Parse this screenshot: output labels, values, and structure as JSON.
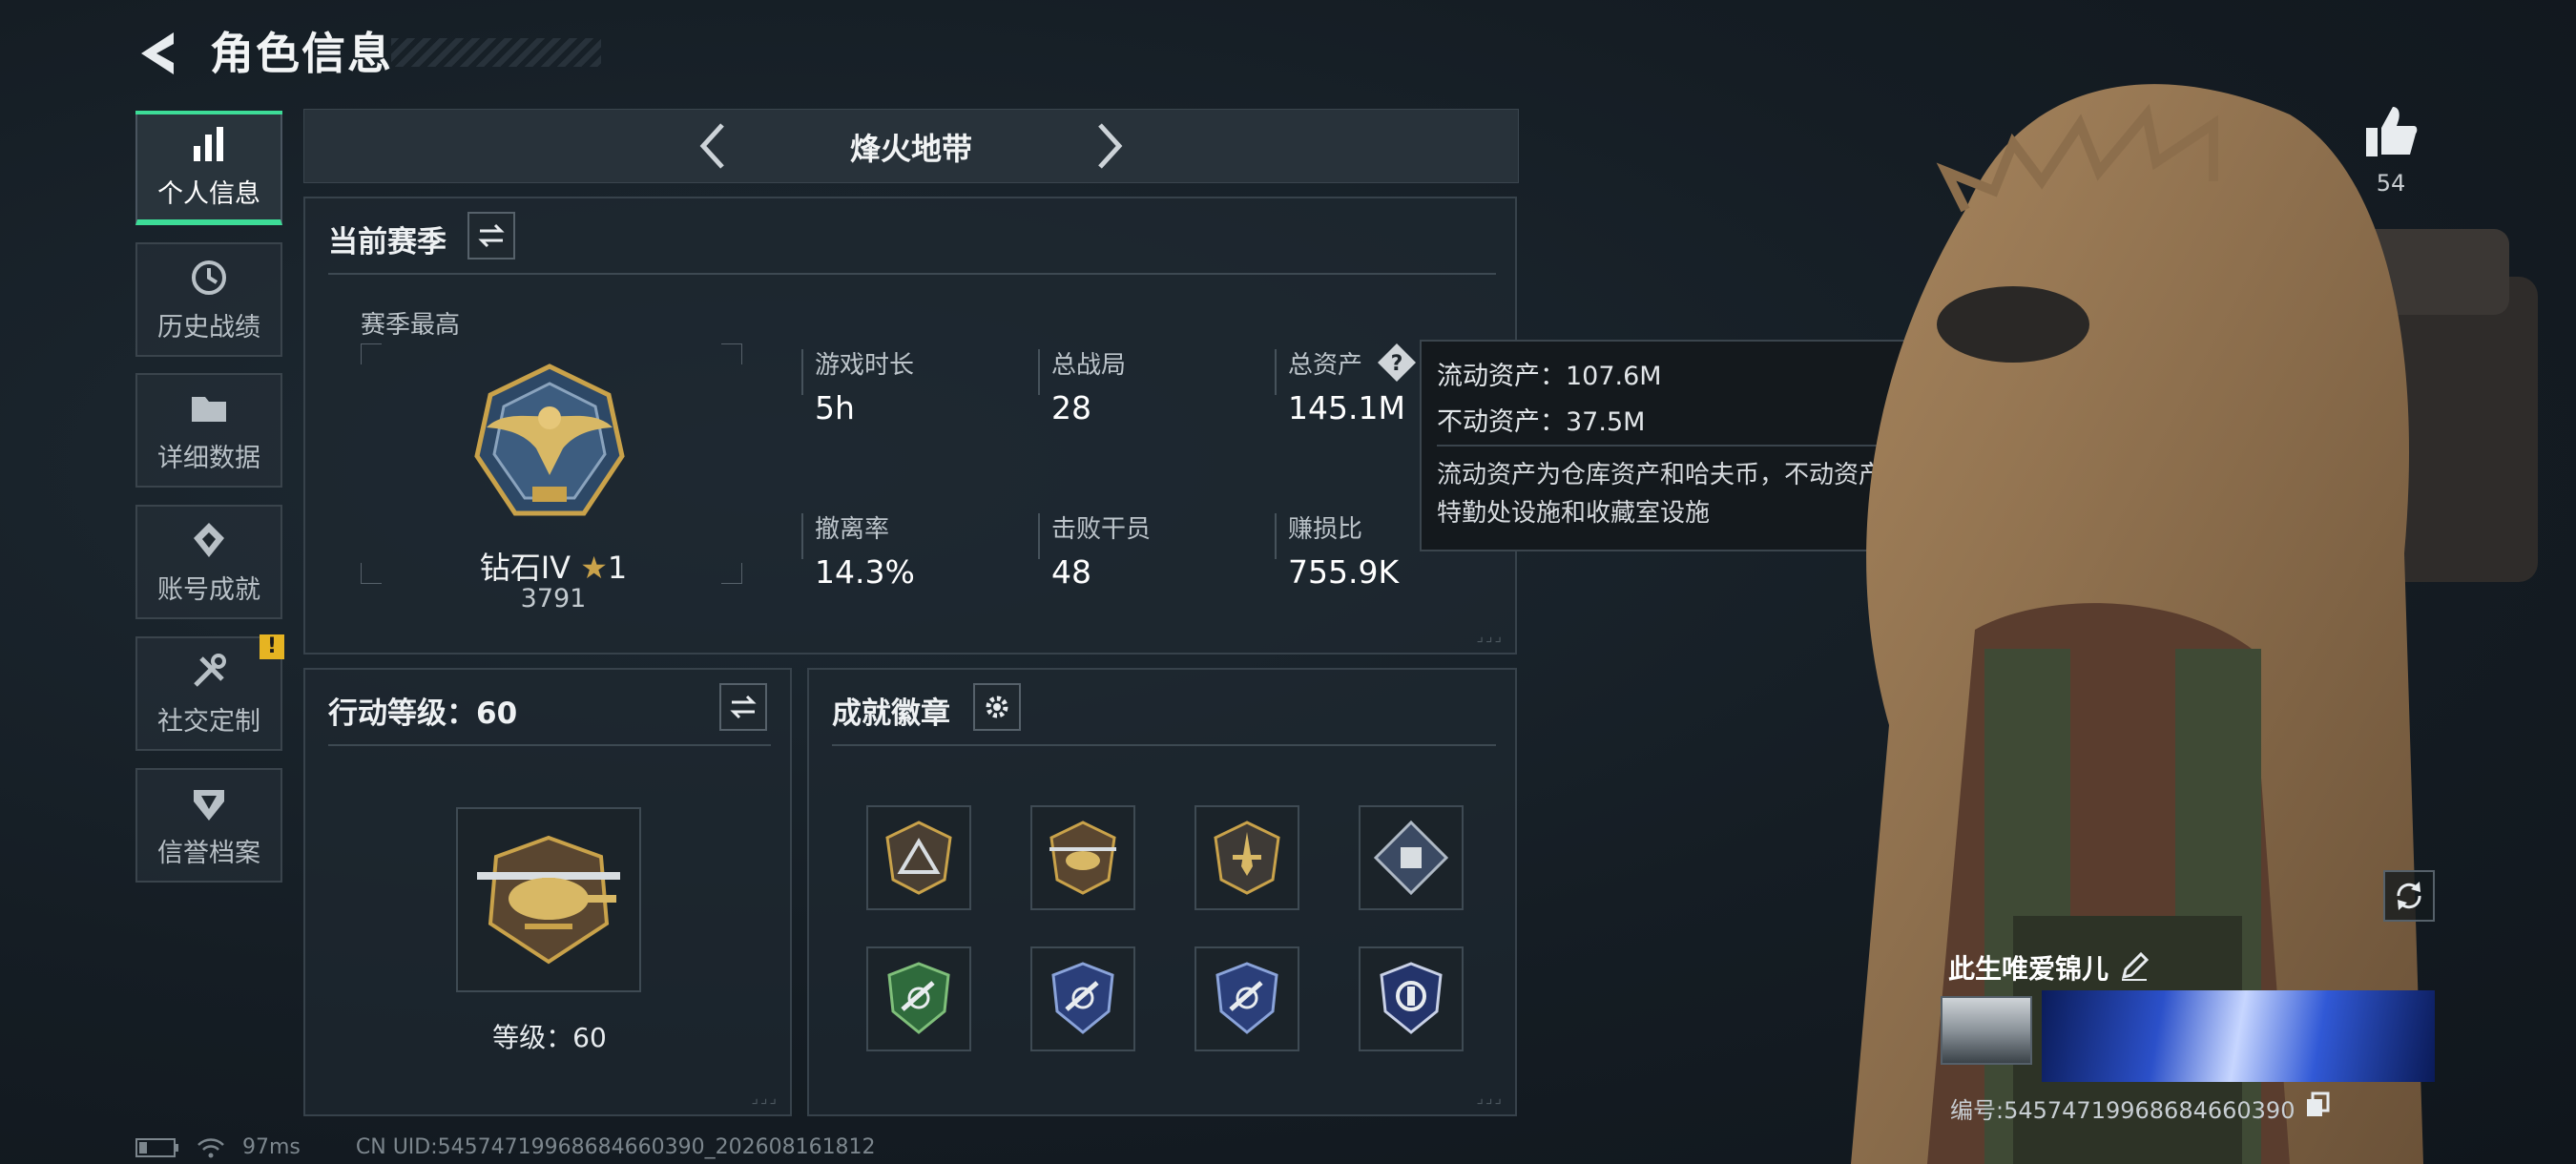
{
  "header": {
    "title": "角色信息"
  },
  "sidebar": {
    "items": [
      {
        "label": "个人信息",
        "active": true,
        "icon": "bar-chart-icon"
      },
      {
        "label": "历史战绩",
        "active": false,
        "icon": "history-icon"
      },
      {
        "label": "详细数据",
        "active": false,
        "icon": "folder-icon"
      },
      {
        "label": "账号成就",
        "active": false,
        "icon": "achievement-icon"
      },
      {
        "label": "社交定制",
        "active": false,
        "icon": "tools-icon",
        "badge": "!"
      },
      {
        "label": "信誉档案",
        "active": false,
        "icon": "shield-icon"
      }
    ]
  },
  "mode": {
    "title": "烽火地带"
  },
  "season": {
    "title": "当前赛季",
    "best_label": "赛季最高",
    "rank_name": "钻石IV",
    "rank_stars": "1",
    "rank_score": "3791",
    "stats": [
      {
        "label": "游戏时长",
        "value": "5h"
      },
      {
        "label": "总战局",
        "value": "28"
      },
      {
        "label": "总资产",
        "value": "145.1M"
      },
      {
        "label": "撤离率",
        "value": "14.3%"
      },
      {
        "label": "击败干员",
        "value": "48"
      },
      {
        "label": "赚损比",
        "value": "755.9K"
      }
    ]
  },
  "tooltip": {
    "liquid": "流动资产：107.6M",
    "fixed": "不动资产：37.5M",
    "desc": "流动资产为仓库资产和哈夫币，不动资产为特勤处设施和收藏室设施"
  },
  "level": {
    "title": "行动等级：60",
    "label": "等级：60"
  },
  "achievements": {
    "title": "成就徽章",
    "badges": [
      "triangle-badge-icon",
      "helicopter-badge-icon",
      "dagger-badge-icon",
      "diamond-badge-icon",
      "green-shield-badge-icon",
      "blue-shield-badge-icon",
      "blue-shield-badge-icon",
      "blue-emblem-badge-icon"
    ]
  },
  "profile": {
    "likes": "54",
    "name": "此生唯爱锦儿",
    "id": "编号:5457471996868466039​0"
  },
  "status": {
    "ping": "97ms",
    "uid": "CN UID:54574719968684660390_202608161812"
  },
  "colors": {
    "accent": "#3ddc97",
    "warning": "#e6b422",
    "gold": "#c9a24a"
  }
}
